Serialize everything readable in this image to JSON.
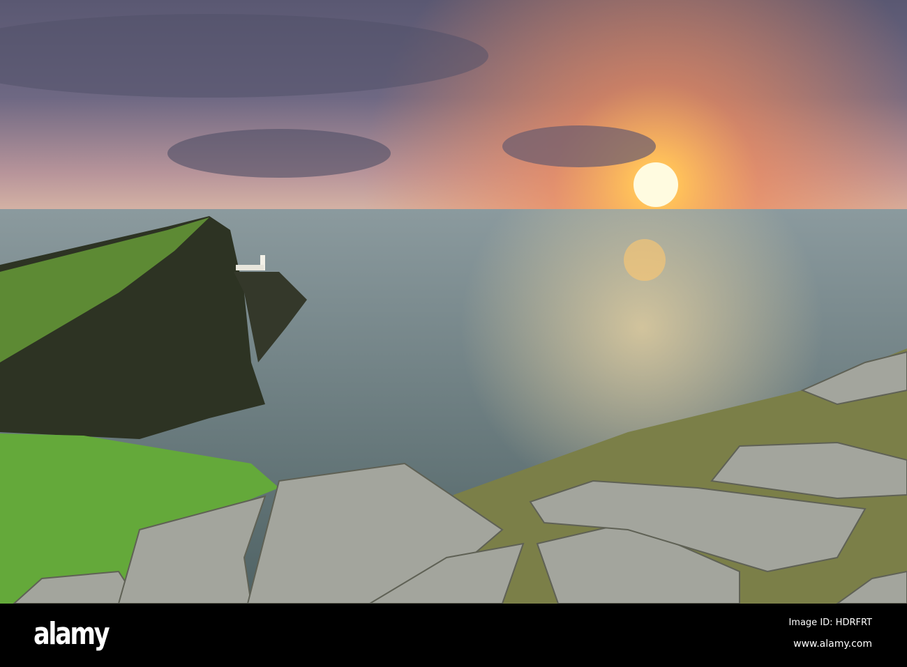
{
  "photo": {
    "subject": "Neist Point lighthouse cliffs at sunset"
  },
  "footer": {
    "logo": "alamy",
    "image_id": "Image ID: HDRFRT",
    "website": "www.alamy.com"
  },
  "colors": {
    "sun": "#fff3b0",
    "sea": "#6f8385",
    "grass": "#5fa83a",
    "rock": "#9a9c94"
  }
}
